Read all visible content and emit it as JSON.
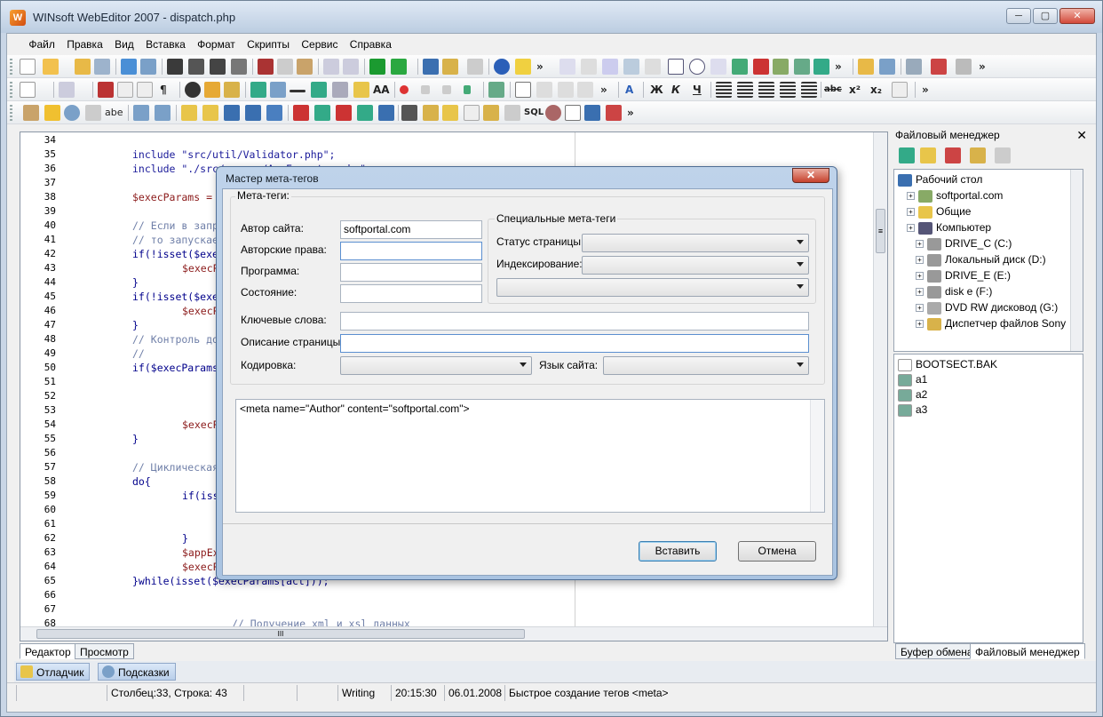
{
  "window": {
    "title": "WINsoft WebEditor 2007 - dispatch.php",
    "min_glyph": "─",
    "max_glyph": "▢",
    "close_glyph": "✕"
  },
  "menu": [
    "Файл",
    "Правка",
    "Вид",
    "Вставка",
    "Формат",
    "Скрипты",
    "Сервис",
    "Справка"
  ],
  "toolbar_text": {
    "b": "Ж",
    "i": "К",
    "u": "Ч",
    "strike": "abc",
    "sup": "x²",
    "sub": "x₂",
    "more": "»",
    "h1": "A",
    "sql": "SQL",
    "aa": "AA",
    "abe": "abe",
    "para": "¶"
  },
  "editor": {
    "line_numbers": [
      "34",
      "35",
      "36",
      "37",
      "38",
      "39",
      "40",
      "41",
      "42",
      "43",
      "44",
      "45",
      "46",
      "47",
      "48",
      "49",
      "50",
      "51",
      "52",
      "53",
      "54",
      "55",
      "56",
      "57",
      "58",
      "59",
      "60",
      "61",
      "62",
      "63",
      "64",
      "65",
      "66",
      "67",
      "68"
    ],
    "lines": [
      {
        "n": 1,
        "indent": 0,
        "text": "",
        "kind": "code"
      },
      {
        "n": 2,
        "indent": 1,
        "text": "include \"src/util/Validator.php\";",
        "kind": "str"
      },
      {
        "n": 3,
        "indent": 1,
        "text": "include \"./src/server/AppExecutor.php\";",
        "kind": "str"
      },
      {
        "n": 4,
        "indent": 0,
        "text": "",
        "kind": "code"
      },
      {
        "n": 5,
        "indent": 1,
        "text": "$execParams = g",
        "kind": "var"
      },
      {
        "n": 6,
        "indent": 0,
        "text": "",
        "kind": "code"
      },
      {
        "n": 7,
        "indent": 1,
        "text": "// Если в запро",
        "kind": "cmt"
      },
      {
        "n": 8,
        "indent": 1,
        "text": "// то запускаем",
        "kind": "cmt"
      },
      {
        "n": 9,
        "indent": 1,
        "text": "if(!isset($exec",
        "kind": "code"
      },
      {
        "n": 10,
        "indent": 2,
        "text": "$execPa",
        "kind": "var"
      },
      {
        "n": 11,
        "indent": 1,
        "text": "}",
        "kind": "code"
      },
      {
        "n": 12,
        "indent": 1,
        "text": "if(!isset($exec",
        "kind": "code"
      },
      {
        "n": 13,
        "indent": 2,
        "text": "$execPa",
        "kind": "var"
      },
      {
        "n": 14,
        "indent": 1,
        "text": "}",
        "kind": "code"
      },
      {
        "n": 15,
        "indent": 1,
        "text": "// Контроль дос",
        "kind": "cmt"
      },
      {
        "n": 16,
        "indent": 1,
        "text": "//",
        "kind": "cmt"
      },
      {
        "n": 17,
        "indent": 1,
        "text": "if($execParams[",
        "kind": "code"
      },
      {
        "n": 18,
        "indent": 0,
        "text": "",
        "kind": "code"
      },
      {
        "n": 19,
        "indent": 0,
        "text": "",
        "kind": "code"
      },
      {
        "n": 20,
        "indent": 0,
        "text": "",
        "kind": "code"
      },
      {
        "n": 21,
        "indent": 2,
        "text": "$execPa",
        "kind": "var"
      },
      {
        "n": 22,
        "indent": 1,
        "text": "}",
        "kind": "code"
      },
      {
        "n": 23,
        "indent": 0,
        "text": "",
        "kind": "code"
      },
      {
        "n": 24,
        "indent": 1,
        "text": "// Циклическая",
        "kind": "cmt"
      },
      {
        "n": 25,
        "indent": 1,
        "text": "do{",
        "kind": "code"
      },
      {
        "n": 26,
        "indent": 2,
        "text": "if(isse",
        "kind": "code"
      },
      {
        "n": 27,
        "indent": 0,
        "text": "",
        "kind": "code"
      },
      {
        "n": 28,
        "indent": 0,
        "text": "",
        "kind": "code"
      },
      {
        "n": 29,
        "indent": 2,
        "text": "}",
        "kind": "code"
      },
      {
        "n": 30,
        "indent": 2,
        "text": "$appExe",
        "kind": "var"
      },
      {
        "n": 31,
        "indent": 2,
        "text": "$execPa",
        "kind": "var"
      },
      {
        "n": 32,
        "indent": 1,
        "text": "}while(isset($execParams[act]));",
        "kind": "code"
      },
      {
        "n": 33,
        "indent": 0,
        "text": "",
        "kind": "code"
      },
      {
        "n": 34,
        "indent": 0,
        "text": "",
        "kind": "code"
      },
      {
        "n": 35,
        "indent": 3,
        "text": "// Получение xml и xsl данных",
        "kind": "cmt"
      }
    ],
    "hscroll_glyph": "III",
    "vscroll_glyph": "≡"
  },
  "editor_tabs": [
    "Редактор",
    "Просмотр"
  ],
  "dock": [
    "Отладчик",
    "Подсказки"
  ],
  "status": {
    "col_row": "Столбец:33, Строка: 43",
    "mode": "Writing",
    "time": "20:15:30",
    "date": "06.01.2008",
    "message": "Быстрое создание тегов <meta>"
  },
  "file_manager": {
    "title": "Файловый менеджер",
    "close": "✕",
    "tree": [
      {
        "label": "Рабочий стол",
        "level": 0,
        "icon": "desktop-icon"
      },
      {
        "label": "softportal.com",
        "level": 1,
        "icon": "user-icon"
      },
      {
        "label": "Общие",
        "level": 1,
        "icon": "folder-icon"
      },
      {
        "label": "Компьютер",
        "level": 1,
        "icon": "computer-icon"
      },
      {
        "label": "DRIVE_C (C:)",
        "level": 2,
        "icon": "drive-icon"
      },
      {
        "label": "Локальный диск (D:)",
        "level": 2,
        "icon": "drive-icon"
      },
      {
        "label": "DRIVE_E (E:)",
        "level": 2,
        "icon": "drive-icon"
      },
      {
        "label": "disk e (F:)",
        "level": 2,
        "icon": "drive-icon"
      },
      {
        "label": "DVD RW дисковод (G:)",
        "level": 2,
        "icon": "dvd-icon"
      },
      {
        "label": "Диспетчер файлов Sony",
        "level": 2,
        "icon": "sony-icon"
      }
    ],
    "files": [
      "BOOTSECT.BAK",
      "a1",
      "a2",
      "a3"
    ],
    "tabs": [
      "Буфер обмена",
      "Файловый менеджер"
    ]
  },
  "dialog": {
    "title": "Мастер мета-тегов",
    "close": "✕",
    "group_meta": "Мета-теги:",
    "group_special": "Специальные мета-теги",
    "labels": {
      "author": "Автор сайта:",
      "copyright": "Авторские права:",
      "program": "Программа:",
      "state": "Состояние:",
      "keywords": "Ключевые слова:",
      "description": "Описание страницы:",
      "encoding": "Кодировка:",
      "language": "Язык сайта:",
      "page_status": "Статус страницы:",
      "indexing": "Индексирование:"
    },
    "values": {
      "author": "softportal.com",
      "copyright": "",
      "program": "",
      "state": "",
      "keywords": "",
      "description": ""
    },
    "preview": "<meta name=\"Author\" content=\"softportal.com\">",
    "insert": "Вставить",
    "cancel": "Отмена"
  }
}
